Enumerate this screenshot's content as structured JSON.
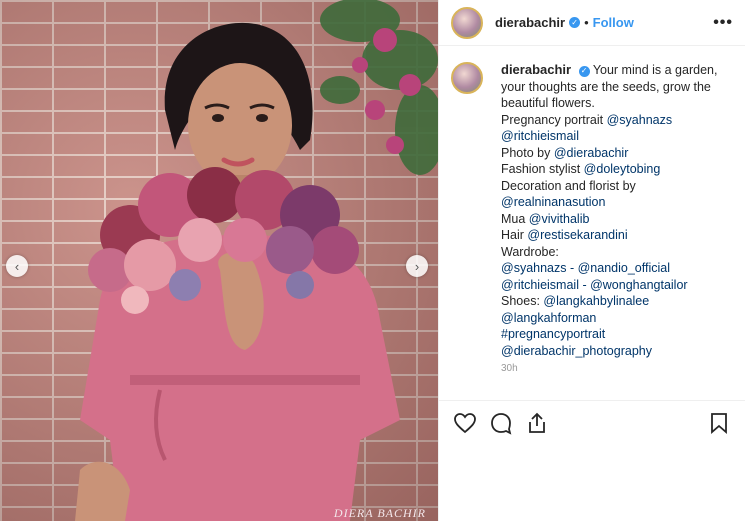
{
  "post": {
    "username": "dierabachir",
    "separator": "•",
    "follow_label": "Follow",
    "more_label": "•••",
    "watermark": "DIERA BACHIR"
  },
  "caption": {
    "username": "dierabachir",
    "lines": [
      {
        "text": "Your mind is a garden, your thoughts are the seeds, grow the beautiful flowers."
      },
      {
        "prefix": "Pregnancy portrait ",
        "mention": "@syahnazs"
      },
      {
        "prefix": "",
        "mention": "@ritchieismail"
      },
      {
        "prefix": "Photo by ",
        "mention": "@dierabachir"
      },
      {
        "prefix": "Fashion stylist ",
        "mention": "@doleytobing"
      },
      {
        "prefix": "Decoration and florist by",
        "mention": ""
      },
      {
        "prefix": "",
        "mention": "@realninanasution"
      },
      {
        "prefix": "Mua ",
        "mention": "@vivithalib"
      },
      {
        "prefix": "Hair ",
        "mention": "@restisekarandini"
      },
      {
        "prefix": "Wardrobe:",
        "mention": ""
      },
      {
        "prefix": "",
        "mention": "@syahnazs - @nandio_official"
      },
      {
        "prefix": "",
        "mention": "@ritchieismail - @wonghangtailor"
      },
      {
        "prefix": "Shoes: ",
        "mention": "@langkahbylinalee"
      },
      {
        "prefix": "",
        "mention": "@langkahforman"
      },
      {
        "prefix": "",
        "mention": "#pregnancyportrait"
      },
      {
        "prefix": "",
        "mention": "@dierabachir_photography"
      }
    ],
    "time": "30h"
  },
  "icons": {
    "like": "heart-icon",
    "comment": "comment-icon",
    "share": "share-icon",
    "save": "bookmark-icon",
    "prev": "chevron-left-icon",
    "next": "chevron-right-icon"
  },
  "colors": {
    "link": "#003569",
    "follow": "#3897f0",
    "dress": "#d4708a"
  }
}
